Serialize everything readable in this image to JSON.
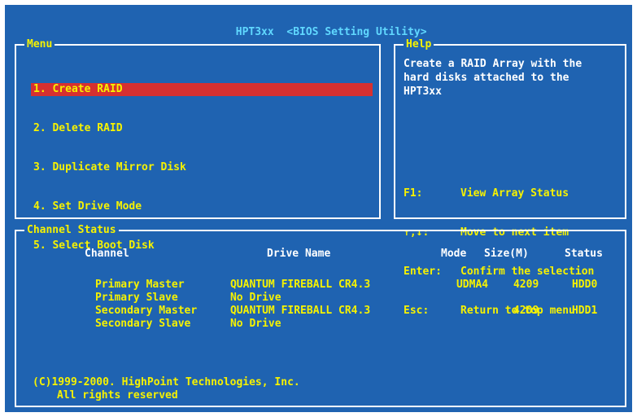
{
  "title": {
    "app": "HPT3xx",
    "subtitle": "<BIOS Setting Utility>"
  },
  "menu": {
    "label": "Menu",
    "items": [
      {
        "label": "1. Create RAID",
        "selected": true
      },
      {
        "label": "2. Delete RAID",
        "selected": false
      },
      {
        "label": "3. Duplicate Mirror Disk",
        "selected": false
      },
      {
        "label": "4. Set Drive Mode",
        "selected": false
      },
      {
        "label": "5. Select Boot Disk",
        "selected": false
      }
    ]
  },
  "help": {
    "label": "Help",
    "description": "Create a RAID Array with the\nhard disks attached to the\nHPT3xx",
    "keys": [
      {
        "key": "F1:",
        "action": "View Array Status"
      },
      {
        "key": "↑,↓:",
        "action": "Move to next item"
      },
      {
        "key": "Enter:",
        "action": "Confirm the selection"
      },
      {
        "key": "Esc:",
        "action": "Return to top menu"
      }
    ]
  },
  "channel_status": {
    "label": "Channel Status",
    "headers": {
      "channel": "Channel",
      "drive_name": "Drive Name",
      "mode": "Mode",
      "size": "Size(M)",
      "status": "Status"
    },
    "rows": [
      {
        "channel": "Primary Master",
        "drive_name": "QUANTUM FIREBALL CR4.3",
        "mode": "UDMA4",
        "size": "4209",
        "status": "HDD0"
      },
      {
        "channel": "Primary Slave",
        "drive_name": "No Drive",
        "mode": "",
        "size": "",
        "status": ""
      },
      {
        "channel": "Secondary Master",
        "drive_name": "QUANTUM FIREBALL CR4.3",
        "mode": "",
        "size": "4209",
        "status": "HDD1"
      },
      {
        "channel": "Secondary Slave",
        "drive_name": "No Drive",
        "mode": "",
        "size": "",
        "status": ""
      }
    ]
  },
  "footer": {
    "copyright": "(C)1999-2000. HighPoint Technologies, Inc.",
    "rights": "All rights reserved"
  },
  "colors": {
    "background": "#1f63b1",
    "text": "#f6f200",
    "title": "#60d8ff",
    "highlight": "#d63030",
    "border": "#ffffff"
  }
}
